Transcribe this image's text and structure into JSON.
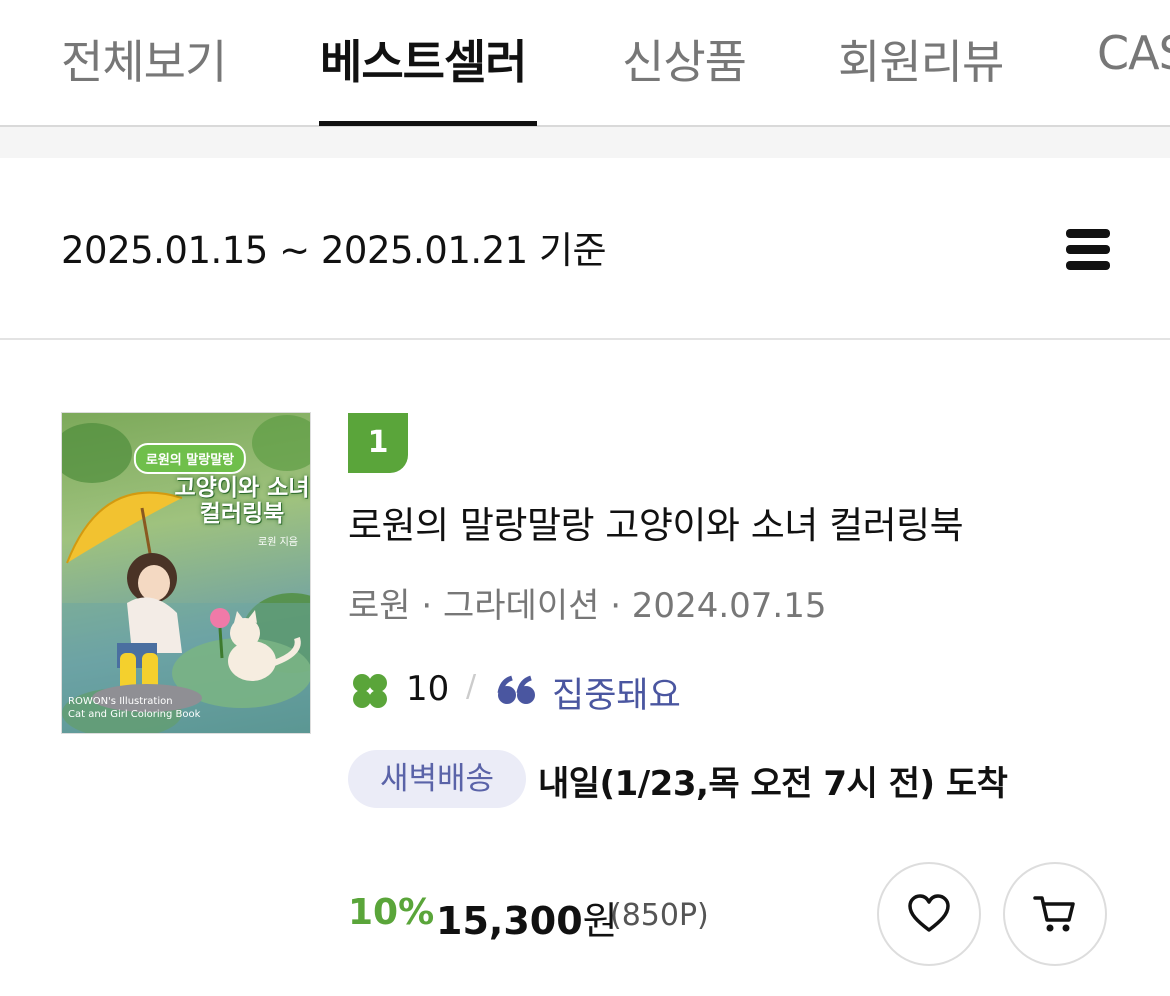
{
  "tabs": [
    {
      "label": "전체보기",
      "active": false
    },
    {
      "label": "베스트셀러",
      "active": true
    },
    {
      "label": "신상품",
      "active": false
    },
    {
      "label": "회원리뷰",
      "active": false
    },
    {
      "label": "CASH",
      "active": false
    }
  ],
  "period": {
    "label": "2025.01.15 ~ 2025.01.21 기준"
  },
  "menu_icon": "hamburger-menu-icon",
  "book": {
    "rank": "1",
    "cover": {
      "series": "로원의 말랑말랑",
      "title_line1": "고양이와 소녀",
      "title_line2": "컬러링북",
      "author": "로원 지음",
      "foot_line1": "ROWON's Illustration",
      "foot_line2": "Cat and Girl Coloring Book"
    },
    "title": "로원의 말랑말랑 고양이와 소녀 컬러링북",
    "meta": "로원 · 그라데이션 · 2024.07.15",
    "rating_icon": "clover-icon",
    "rating": "10",
    "rating_separator": "/",
    "review_icon": "quote-icon",
    "review_keyword": "집중돼요",
    "delivery_badge": "새벽배송",
    "delivery_text": "내일(1/23,목 오전 7시 전) 도착",
    "discount": "10%",
    "price": "15,300",
    "price_unit": "원",
    "points": "(850P)"
  },
  "colors": {
    "accent_green": "#5aa53a",
    "review_blue": "#4a56a0",
    "badge_bg": "#ebecf7"
  }
}
